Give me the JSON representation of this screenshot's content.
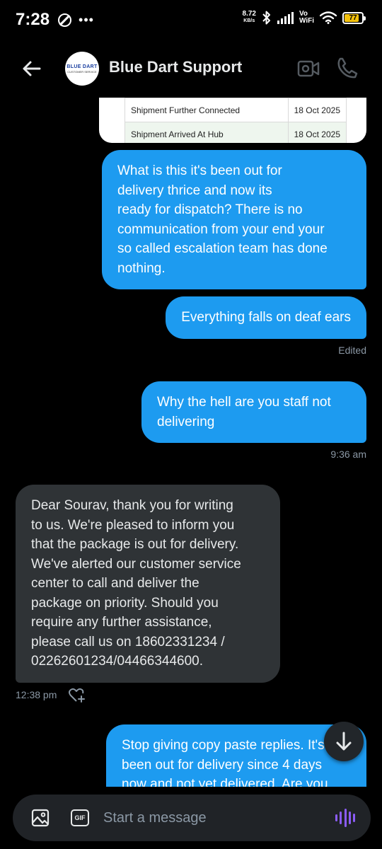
{
  "status_bar": {
    "time": "7:28",
    "net_speed_value": "8.72",
    "net_speed_unit": "KB/s",
    "vo_label": "Vo",
    "wifi_label": "WiFi",
    "battery": "77"
  },
  "header": {
    "avatar_brand": "BLUE DART",
    "avatar_sub": "CUSTOMER SERVICE",
    "title": "Blue Dart Support"
  },
  "image_table": {
    "rows": [
      {
        "status": "Shipment Further Connected",
        "date": "18 Oct 2025"
      },
      {
        "status": "Shipment Arrived At Hub",
        "date": "18 Oct 2025"
      }
    ]
  },
  "messages": [
    {
      "text": "What is this it's been out for\ndelivery thrice and now its\nready for dispatch? There is no\ncommunication from your end your\nso called escalation team has done\nnothing."
    },
    {
      "text": "Everything falls on deaf ears",
      "meta": "Edited"
    },
    {
      "text": "Why the hell are you staff not\ndelivering",
      "meta": "9:36 am"
    },
    {
      "text": "Dear Sourav, thank you for writing\nto us. We're pleased to inform you\nthat the package is out for delivery.\nWe've alerted our customer service\ncenter to call and deliver the\npackage on priority. Should you\nrequire any further assistance,\nplease call us on 18602331234 /\n02262601234/04466344600.",
      "meta": "12:38 pm"
    },
    {
      "text": "Stop giving copy paste replies. It's\nbeen out for delivery since 4 days\nnow and not yet delivered. Are you"
    }
  ],
  "composer": {
    "gif_label": "GIF",
    "placeholder": "Start a message"
  },
  "colors": {
    "outgoing_bubble": "#1d9bf0",
    "incoming_bubble": "#2f3336",
    "voice_accent": "#8b5cf6"
  }
}
